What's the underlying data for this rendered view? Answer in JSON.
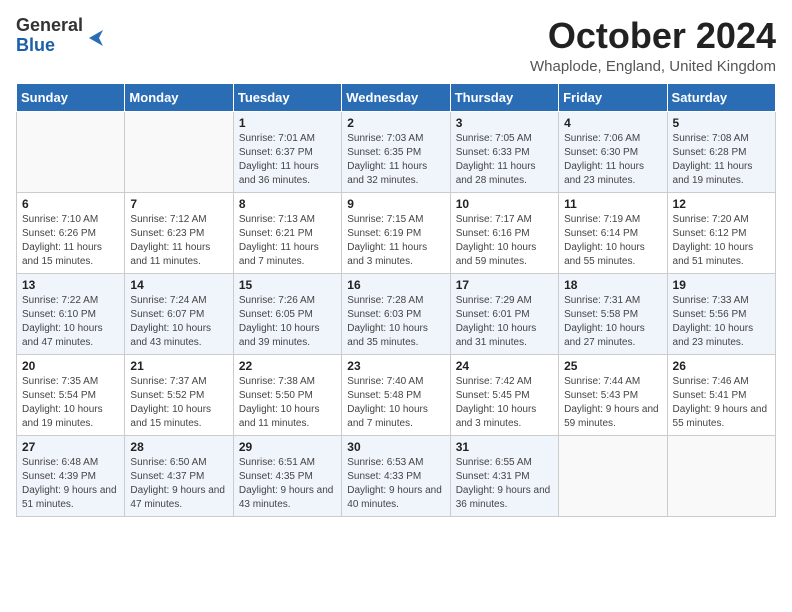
{
  "logo": {
    "general": "General",
    "blue": "Blue"
  },
  "title": "October 2024",
  "location": "Whaplode, England, United Kingdom",
  "days_of_week": [
    "Sunday",
    "Monday",
    "Tuesday",
    "Wednesday",
    "Thursday",
    "Friday",
    "Saturday"
  ],
  "weeks": [
    [
      {
        "day": "",
        "info": ""
      },
      {
        "day": "",
        "info": ""
      },
      {
        "day": "1",
        "info": "Sunrise: 7:01 AM\nSunset: 6:37 PM\nDaylight: 11 hours and 36 minutes."
      },
      {
        "day": "2",
        "info": "Sunrise: 7:03 AM\nSunset: 6:35 PM\nDaylight: 11 hours and 32 minutes."
      },
      {
        "day": "3",
        "info": "Sunrise: 7:05 AM\nSunset: 6:33 PM\nDaylight: 11 hours and 28 minutes."
      },
      {
        "day": "4",
        "info": "Sunrise: 7:06 AM\nSunset: 6:30 PM\nDaylight: 11 hours and 23 minutes."
      },
      {
        "day": "5",
        "info": "Sunrise: 7:08 AM\nSunset: 6:28 PM\nDaylight: 11 hours and 19 minutes."
      }
    ],
    [
      {
        "day": "6",
        "info": "Sunrise: 7:10 AM\nSunset: 6:26 PM\nDaylight: 11 hours and 15 minutes."
      },
      {
        "day": "7",
        "info": "Sunrise: 7:12 AM\nSunset: 6:23 PM\nDaylight: 11 hours and 11 minutes."
      },
      {
        "day": "8",
        "info": "Sunrise: 7:13 AM\nSunset: 6:21 PM\nDaylight: 11 hours and 7 minutes."
      },
      {
        "day": "9",
        "info": "Sunrise: 7:15 AM\nSunset: 6:19 PM\nDaylight: 11 hours and 3 minutes."
      },
      {
        "day": "10",
        "info": "Sunrise: 7:17 AM\nSunset: 6:16 PM\nDaylight: 10 hours and 59 minutes."
      },
      {
        "day": "11",
        "info": "Sunrise: 7:19 AM\nSunset: 6:14 PM\nDaylight: 10 hours and 55 minutes."
      },
      {
        "day": "12",
        "info": "Sunrise: 7:20 AM\nSunset: 6:12 PM\nDaylight: 10 hours and 51 minutes."
      }
    ],
    [
      {
        "day": "13",
        "info": "Sunrise: 7:22 AM\nSunset: 6:10 PM\nDaylight: 10 hours and 47 minutes."
      },
      {
        "day": "14",
        "info": "Sunrise: 7:24 AM\nSunset: 6:07 PM\nDaylight: 10 hours and 43 minutes."
      },
      {
        "day": "15",
        "info": "Sunrise: 7:26 AM\nSunset: 6:05 PM\nDaylight: 10 hours and 39 minutes."
      },
      {
        "day": "16",
        "info": "Sunrise: 7:28 AM\nSunset: 6:03 PM\nDaylight: 10 hours and 35 minutes."
      },
      {
        "day": "17",
        "info": "Sunrise: 7:29 AM\nSunset: 6:01 PM\nDaylight: 10 hours and 31 minutes."
      },
      {
        "day": "18",
        "info": "Sunrise: 7:31 AM\nSunset: 5:58 PM\nDaylight: 10 hours and 27 minutes."
      },
      {
        "day": "19",
        "info": "Sunrise: 7:33 AM\nSunset: 5:56 PM\nDaylight: 10 hours and 23 minutes."
      }
    ],
    [
      {
        "day": "20",
        "info": "Sunrise: 7:35 AM\nSunset: 5:54 PM\nDaylight: 10 hours and 19 minutes."
      },
      {
        "day": "21",
        "info": "Sunrise: 7:37 AM\nSunset: 5:52 PM\nDaylight: 10 hours and 15 minutes."
      },
      {
        "day": "22",
        "info": "Sunrise: 7:38 AM\nSunset: 5:50 PM\nDaylight: 10 hours and 11 minutes."
      },
      {
        "day": "23",
        "info": "Sunrise: 7:40 AM\nSunset: 5:48 PM\nDaylight: 10 hours and 7 minutes."
      },
      {
        "day": "24",
        "info": "Sunrise: 7:42 AM\nSunset: 5:45 PM\nDaylight: 10 hours and 3 minutes."
      },
      {
        "day": "25",
        "info": "Sunrise: 7:44 AM\nSunset: 5:43 PM\nDaylight: 9 hours and 59 minutes."
      },
      {
        "day": "26",
        "info": "Sunrise: 7:46 AM\nSunset: 5:41 PM\nDaylight: 9 hours and 55 minutes."
      }
    ],
    [
      {
        "day": "27",
        "info": "Sunrise: 6:48 AM\nSunset: 4:39 PM\nDaylight: 9 hours and 51 minutes."
      },
      {
        "day": "28",
        "info": "Sunrise: 6:50 AM\nSunset: 4:37 PM\nDaylight: 9 hours and 47 minutes."
      },
      {
        "day": "29",
        "info": "Sunrise: 6:51 AM\nSunset: 4:35 PM\nDaylight: 9 hours and 43 minutes."
      },
      {
        "day": "30",
        "info": "Sunrise: 6:53 AM\nSunset: 4:33 PM\nDaylight: 9 hours and 40 minutes."
      },
      {
        "day": "31",
        "info": "Sunrise: 6:55 AM\nSunset: 4:31 PM\nDaylight: 9 hours and 36 minutes."
      },
      {
        "day": "",
        "info": ""
      },
      {
        "day": "",
        "info": ""
      }
    ]
  ]
}
